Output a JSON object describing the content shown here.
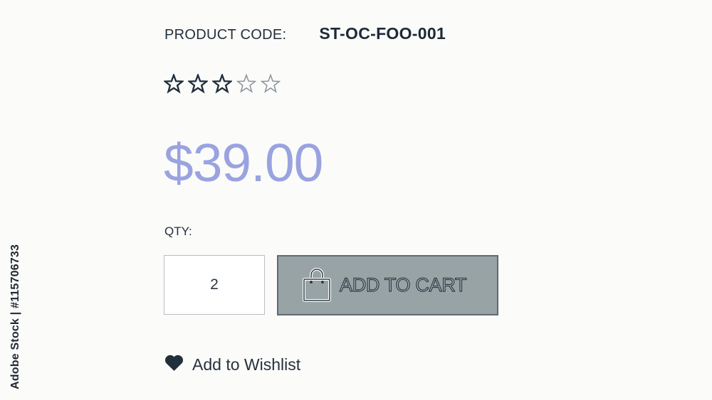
{
  "product": {
    "code_label": "PRODUCT CODE:",
    "code_value": "ST-OC-FOO-001",
    "rating": 3,
    "rating_max": 5,
    "price": "$39.00"
  },
  "purchase": {
    "qty_label": "QTY:",
    "qty_value": "2",
    "add_to_cart_label": "ADD TO CART",
    "cart_icon": "shopping-bag-icon"
  },
  "wishlist": {
    "label": "Add to Wishlist",
    "icon": "heart-icon"
  },
  "watermark": {
    "credit": "Adobe Stock | #115706733"
  },
  "colors": {
    "price": "#9aa3e0",
    "button_bg": "#98a3a5",
    "button_border": "#5e6a72",
    "text_dark": "#1f2d3a"
  }
}
